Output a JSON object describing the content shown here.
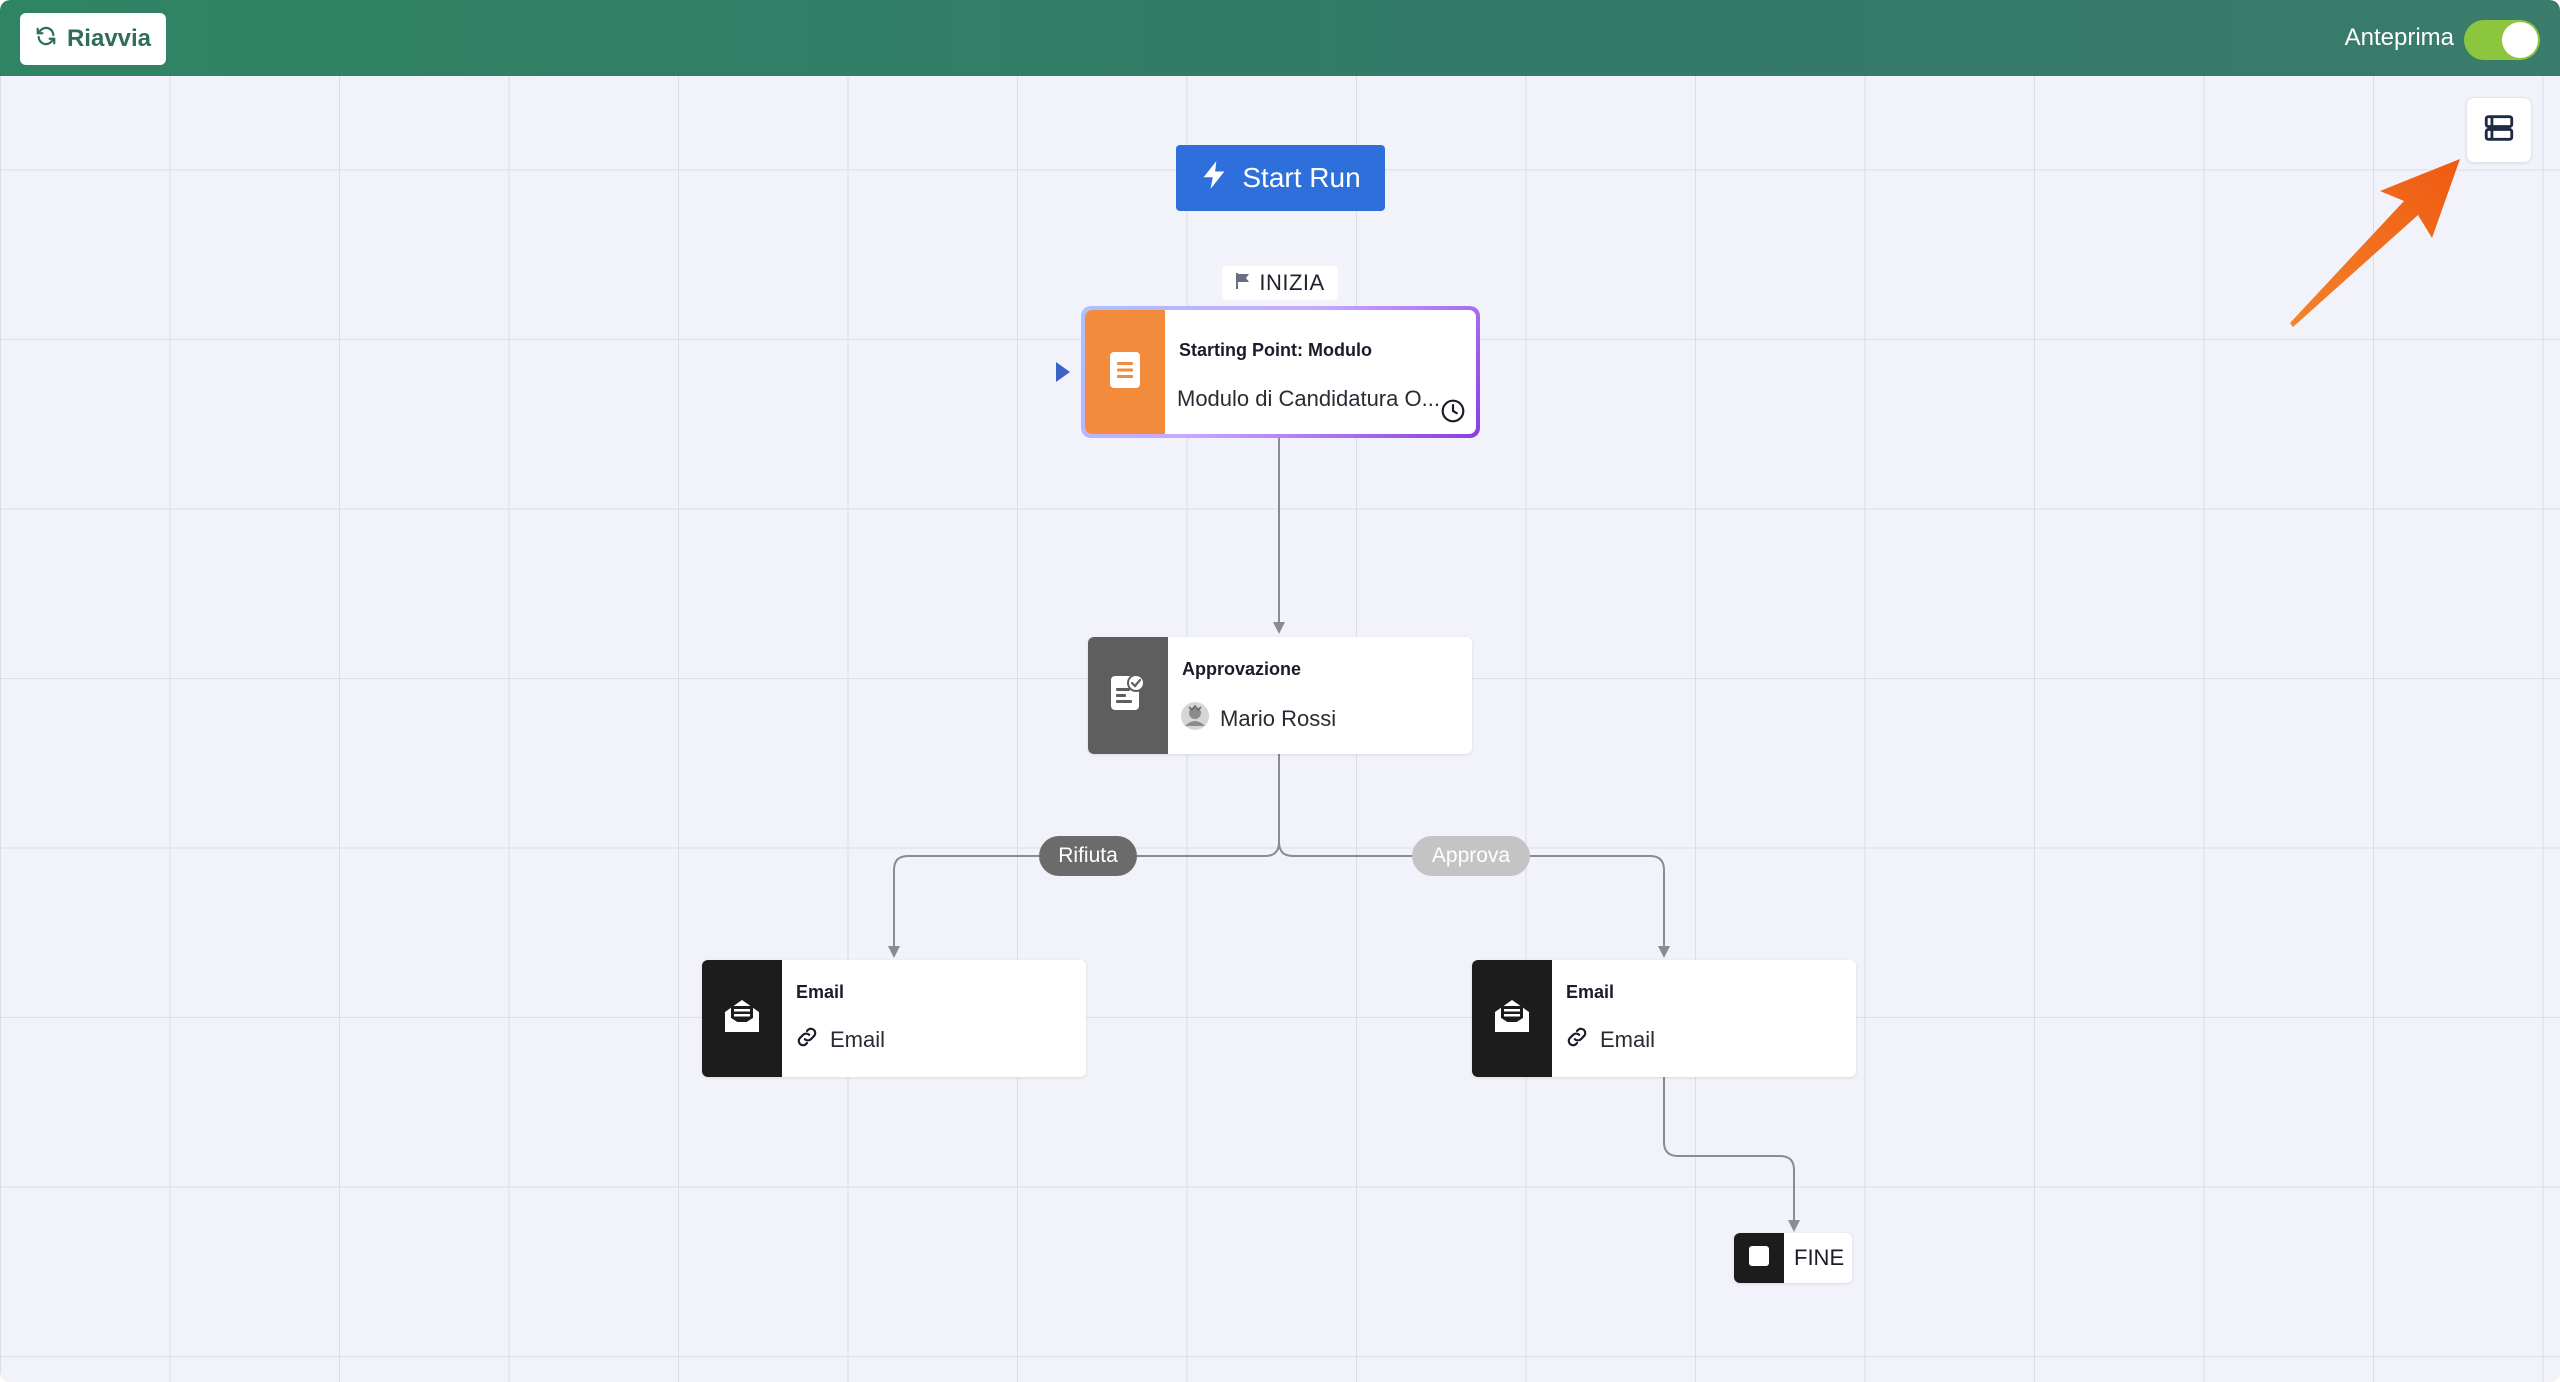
{
  "header": {
    "restart_label": "Riavvia",
    "preview_label": "Anteprima",
    "preview_enabled": true
  },
  "canvas": {
    "start_run_label": "Start Run",
    "start_tag": "INIZIA",
    "start_node": {
      "title": "Starting Point: Modulo",
      "subtitle": "Modulo di Candidatura O...",
      "icon": "form-icon",
      "color": "#f28b3c"
    },
    "approval_node": {
      "title": "Approvazione",
      "assignee": "Mario Rossi",
      "icon": "approval-icon",
      "color": "#5e5e5e"
    },
    "branches": {
      "reject_label": "Rifiuta",
      "approve_label": "Approva"
    },
    "email_left": {
      "title": "Email",
      "subtitle": "Email",
      "icon": "email-icon"
    },
    "email_right": {
      "title": "Email",
      "subtitle": "Email",
      "icon": "email-icon"
    },
    "end_node": {
      "label": "FINE"
    }
  },
  "colors": {
    "header_green": "#2f8463",
    "start_run_blue": "#2f6fdb",
    "toggle_green": "#8cc63f",
    "callout_orange": "#f26d1a"
  }
}
